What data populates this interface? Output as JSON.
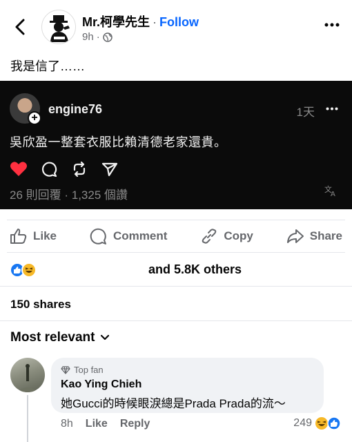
{
  "header": {
    "page_name": "Mr.柯學先生",
    "separator": "·",
    "follow_label": "Follow",
    "time": "9h",
    "time_separator": "·"
  },
  "post": {
    "text": "我是信了……"
  },
  "embed": {
    "username": "engine76",
    "time": "1天",
    "text": "吳欣盈一整套衣服比賴清德老家還貴。",
    "stats": "26 則回覆 · 1,325 個讚"
  },
  "actions": {
    "like": "Like",
    "comment": "Comment",
    "copy": "Copy",
    "share": "Share"
  },
  "reactions": {
    "text": "and 5.8K others"
  },
  "shares": "150 shares",
  "sort": {
    "label": "Most relevant"
  },
  "comment": {
    "badge": "Top fan",
    "author": "Kao Ying Chieh",
    "text": "她Gucci的時候眼淚總是Prada Prada的流～",
    "time": "8h",
    "like_label": "Like",
    "reply_label": "Reply",
    "reaction_count": "249"
  },
  "colors": {
    "accent": "#0866ff",
    "like_blue": "#1877f2",
    "haha_yellow": "#f7b928",
    "heart_red": "#ff3040",
    "embed_bg": "#0b0b0b"
  }
}
